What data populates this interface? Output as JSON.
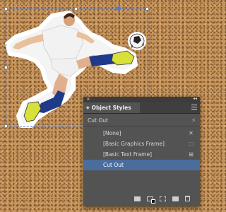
{
  "panel": {
    "title": "Object Styles",
    "current_style": "Cut Out",
    "styles": [
      {
        "label": "[None]",
        "icon": "none-style-icon",
        "selected": false
      },
      {
        "label": "[Basic Graphics Frame]",
        "icon": "graphics-frame-icon",
        "selected": false
      },
      {
        "label": "[Basic Text Frame]",
        "icon": "text-frame-icon",
        "selected": false
      },
      {
        "label": "Cut Out",
        "icon": "",
        "selected": true
      }
    ],
    "footer_icons": [
      "new-style-group-icon",
      "clear-overrides-icon",
      "clear-attributes-icon",
      "create-new-style-icon",
      "delete-style-icon"
    ]
  },
  "colors": {
    "cork": "#c7955c",
    "panel_bg": "#535353",
    "selection": "#4a6d9e",
    "frame_selection": "#4a7be0",
    "jersey": "#f2f2f2",
    "shorts_blue": "#1f3a8a",
    "boot_yellow": "#d8e03a"
  }
}
